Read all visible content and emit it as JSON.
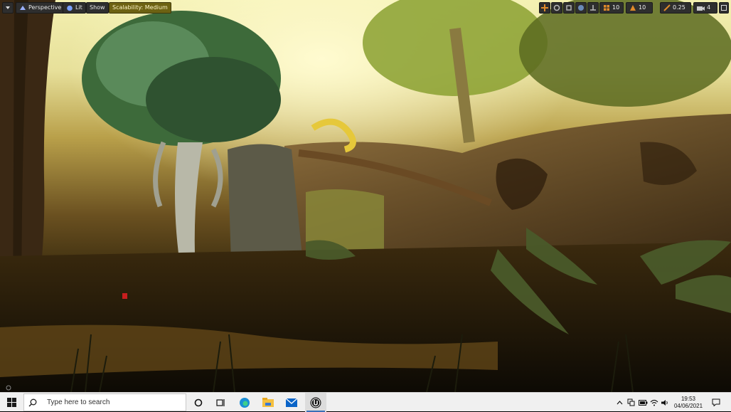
{
  "viewport_toolbar": {
    "view_mode": "Perspective",
    "lighting_mode": "Lit",
    "show_label": "Show",
    "scalability_label": "Scalability: Medium",
    "grid_snap_value": "10",
    "rotation_snap_value": "10",
    "scale_snap_value": "0.25",
    "camera_speed_value": "4"
  },
  "taskbar": {
    "search_placeholder": "Type here to search",
    "clock_time": "19:53",
    "clock_date": "04/06/2021"
  },
  "colors": {
    "taskbar_bg": "#f0f0f0",
    "scalability_badge": "#6d6212",
    "toolbar_button_bg": "#2e2e2e",
    "windows_blue": "#0a64c8"
  },
  "icons": [
    "windows-logo-icon",
    "search-icon",
    "cortana-circle-icon",
    "task-view-icon",
    "edge-icon",
    "file-explorer-icon",
    "mail-icon",
    "unreal-engine-icon",
    "chevron-up-icon",
    "network-icon",
    "battery-icon",
    "wifi-icon",
    "volume-icon",
    "notification-icon"
  ]
}
